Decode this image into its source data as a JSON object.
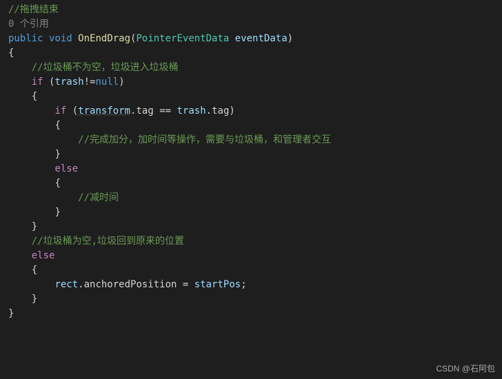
{
  "code": {
    "l1_comment": "//拖拽结束",
    "l2_refs": "0 个引用",
    "l3": {
      "public": "public",
      "void": "void",
      "method": "OnEndDrag",
      "type": "PointerEventData",
      "param": "eventData"
    },
    "l4_brace": "{",
    "l5_comment": "//垃圾桶不为空，垃圾进入垃圾桶",
    "l6": {
      "if": "if",
      "trash": "trash",
      "neq": "!=",
      "null": "null"
    },
    "l7_brace": "{",
    "l8": {
      "if": "if",
      "transform": "transform",
      "dot": ".",
      "tag": "tag",
      "eq": "==",
      "trash": "trash"
    },
    "l9_brace": "{",
    "l10_comment": "//完成加分，加时间等操作，需要与垃圾桶，和管理者交互",
    "l11_brace": "}",
    "l12_else": "else",
    "l13_brace": "{",
    "l14_comment": "//减时间",
    "l15_brace": "}",
    "l16_brace": "}",
    "l17_comment": "//垃圾桶为空,垃圾回到原来的位置",
    "l18_else": "else",
    "l19_brace": "{",
    "l20": {
      "rect": "rect",
      "dot": ".",
      "anchoredPosition": "anchoredPosition",
      "eq": "=",
      "startPos": "startPos",
      "semi": ";"
    },
    "l21_brace": "}",
    "l22_brace": "}"
  },
  "watermark": "CSDN @石阿包"
}
